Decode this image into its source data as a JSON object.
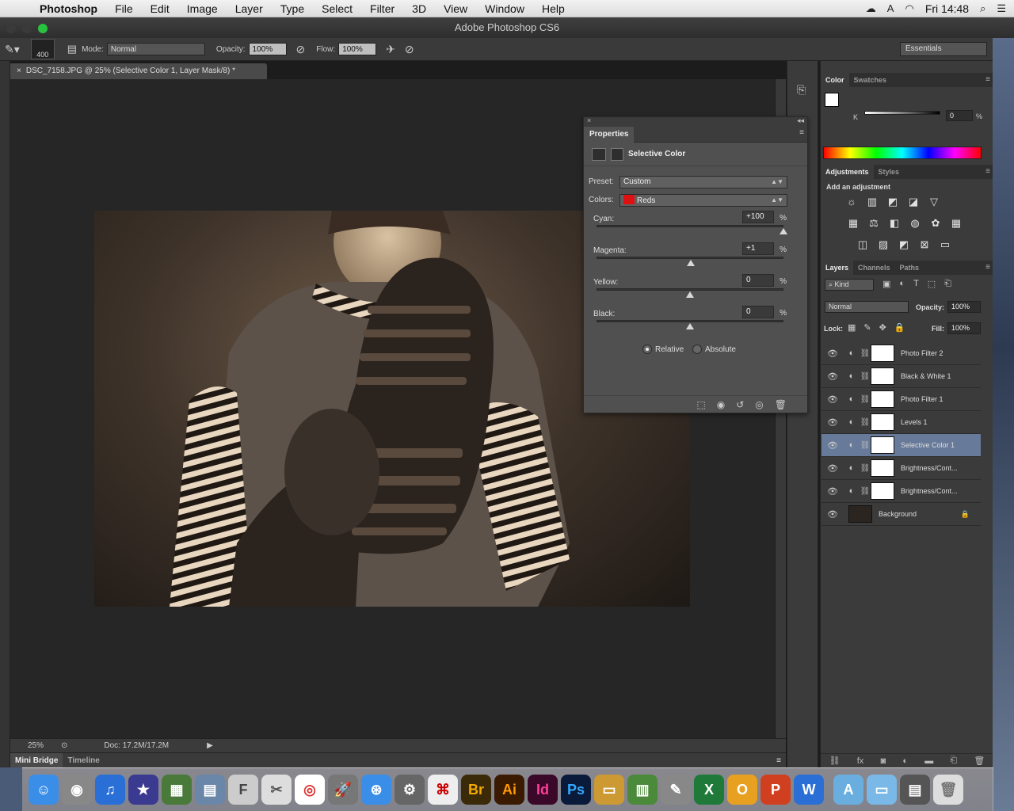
{
  "menubar": {
    "app": "Photoshop",
    "items": [
      "File",
      "Edit",
      "Image",
      "Layer",
      "Type",
      "Select",
      "Filter",
      "3D",
      "View",
      "Window",
      "Help"
    ],
    "clock": "Fri 14:48"
  },
  "window": {
    "title": "Adobe Photoshop CS6"
  },
  "options": {
    "brush_size": "400",
    "mode_label": "Mode:",
    "mode_value": "Normal",
    "opacity_label": "Opacity:",
    "opacity_value": "100%",
    "flow_label": "Flow:",
    "flow_value": "100%",
    "workspace": "Essentials"
  },
  "document": {
    "tab_title": "DSC_7158.JPG @ 25% (Selective Color 1, Layer Mask/8) *",
    "zoom": "25%",
    "doc_size": "Doc: 17.2M/17.2M"
  },
  "bottom_tabs": [
    "Mini Bridge",
    "Timeline"
  ],
  "properties": {
    "tab": "Properties",
    "title": "Selective Color",
    "preset_label": "Preset:",
    "preset_value": "Custom",
    "colors_label": "Colors:",
    "colors_value": "Reds",
    "sliders": [
      {
        "label": "Cyan:",
        "value": "+100",
        "pct": "%",
        "level": 1.0
      },
      {
        "label": "Magenta:",
        "value": "+1",
        "pct": "%",
        "level": 0.505
      },
      {
        "label": "Yellow:",
        "value": "0",
        "pct": "%",
        "level": 0.5
      },
      {
        "label": "Black:",
        "value": "0",
        "pct": "%",
        "level": 0.5
      }
    ],
    "method_relative": "Relative",
    "method_absolute": "Absolute",
    "method_selected": "Relative"
  },
  "color_panel": {
    "tabs": [
      "Color",
      "Swatches"
    ],
    "channel": "K",
    "value": "0",
    "pct": "%"
  },
  "adjustments_panel": {
    "tabs": [
      "Adjustments",
      "Styles"
    ],
    "heading": "Add an adjustment"
  },
  "layers_panel": {
    "tabs": [
      "Layers",
      "Channels",
      "Paths"
    ],
    "kind": "Kind",
    "blend": "Normal",
    "opacity_label": "Opacity:",
    "opacity_value": "100%",
    "lock_label": "Lock:",
    "fill_label": "Fill:",
    "fill_value": "100%",
    "layers": [
      {
        "name": "Photo Filter 2",
        "selected": false
      },
      {
        "name": "Black & White 1",
        "selected": false
      },
      {
        "name": "Photo Filter 1",
        "selected": false
      },
      {
        "name": "Levels 1",
        "selected": false
      },
      {
        "name": "Selective Color 1",
        "selected": true
      },
      {
        "name": "Brightness/Cont...",
        "selected": false
      },
      {
        "name": "Brightness/Cont...",
        "selected": false
      },
      {
        "name": "Background",
        "selected": false
      }
    ]
  },
  "dock": {
    "labels": [
      "Br",
      "Ai",
      "Id",
      "Ps"
    ]
  }
}
